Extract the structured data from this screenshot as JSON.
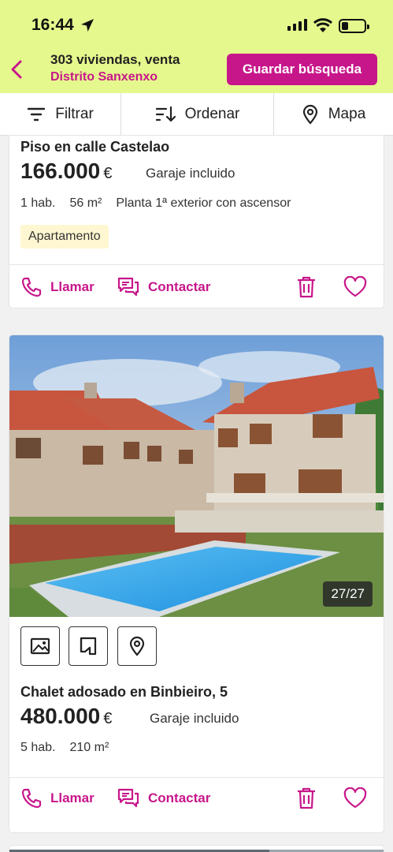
{
  "status_bar": {
    "time": "16:44"
  },
  "header": {
    "title": "303 viviendas, venta",
    "subtitle": "Distrito Sanxenxo",
    "save_label": "Guardar búsqueda"
  },
  "toolbar": {
    "filter_label": "Filtrar",
    "sort_label": "Ordenar",
    "map_label": "Mapa"
  },
  "listings": [
    {
      "title": "Piso en calle Castelao",
      "price": "166.000",
      "currency": "€",
      "note": "Garaje incluido",
      "details": [
        "1 hab.",
        "56 m²",
        "Planta 1ª exterior con ascensor"
      ],
      "tag": "Apartamento",
      "call_label": "Llamar",
      "contact_label": "Contactar"
    },
    {
      "title": "Chalet adosado en Binbieiro, 5",
      "price": "480.000",
      "currency": "€",
      "note": "Garaje incluido",
      "details": [
        "5 hab.",
        "210 m²"
      ],
      "photo_counter": "27/27",
      "call_label": "Llamar",
      "contact_label": "Contactar"
    }
  ],
  "colors": {
    "brand": "#c7168a",
    "header_bg": "#e5f88d",
    "tag_bg": "#fff7d1"
  }
}
